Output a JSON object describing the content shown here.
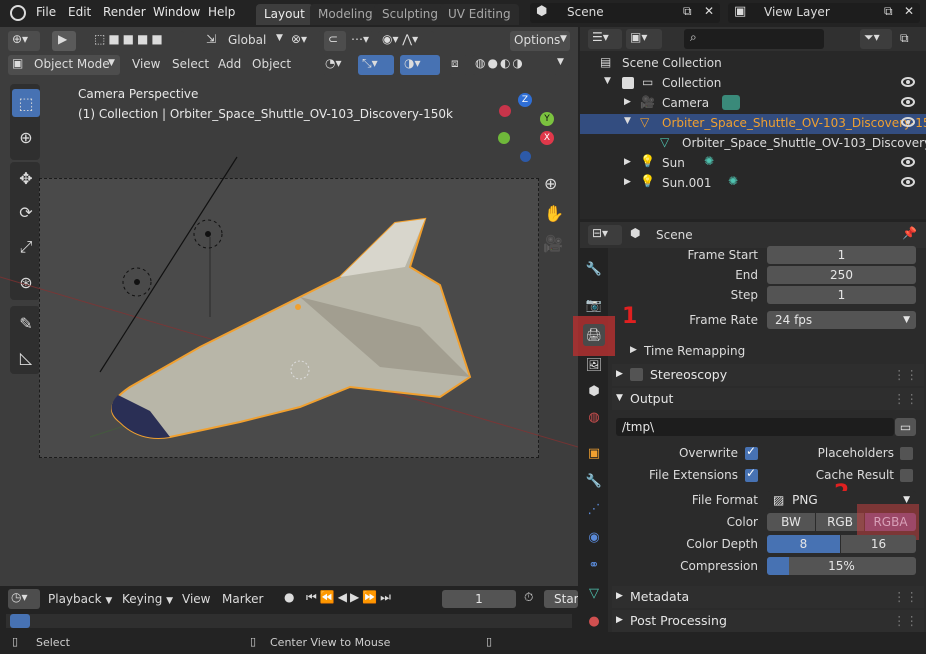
{
  "menubar": {
    "items": [
      "File",
      "Edit",
      "Render",
      "Window",
      "Help"
    ],
    "workspaces": [
      "Layout",
      "Modeling",
      "Sculpting",
      "UV Editing"
    ],
    "active_workspace": "Layout",
    "scene": "Scene",
    "view_layer": "View Layer"
  },
  "viewport": {
    "transform_orientation": "Global",
    "options_label": "Options",
    "mode": "Object Mode",
    "menu": [
      "View",
      "Select",
      "Add",
      "Object"
    ],
    "overlay_title": "Camera Perspective",
    "overlay_subtitle": "(1) Collection | Orbiter_Space_Shuttle_OV-103_Discovery-150k",
    "gizmo_axes": [
      "Z",
      "Y",
      "X"
    ]
  },
  "outliner": {
    "root": "Scene Collection",
    "rows": [
      {
        "label": "Collection",
        "indent": 1
      },
      {
        "label": "Camera",
        "indent": 2
      },
      {
        "label": "Orbiter_Space_Shuttle_OV-103_Discovery-150",
        "indent": 2
      },
      {
        "label": "Orbiter_Space_Shuttle_OV-103_Discovery-",
        "indent": 3
      },
      {
        "label": "Sun",
        "indent": 2
      },
      {
        "label": "Sun.001",
        "indent": 2
      }
    ]
  },
  "properties": {
    "context": "Scene",
    "frame_start_label": "Frame Start",
    "frame_start": "1",
    "end_label": "End",
    "end": "250",
    "step_label": "Step",
    "step": "1",
    "frame_rate_label": "Frame Rate",
    "frame_rate": "24 fps",
    "time_remapping": "Time Remapping",
    "stereoscopy": "Stereoscopy",
    "output": "Output",
    "output_path": "/tmp\\",
    "overwrite": "Overwrite",
    "placeholders": "Placeholders",
    "file_extensions": "File Extensions",
    "cache_result": "Cache Result",
    "file_format_label": "File Format",
    "file_format": "PNG",
    "color_label": "Color",
    "color_options": [
      "BW",
      "RGB",
      "RGBA"
    ],
    "color_selected": "RGBA",
    "color_depth_label": "Color Depth",
    "color_depth_options": [
      "8",
      "16"
    ],
    "color_depth_selected": "8",
    "compression_label": "Compression",
    "compression": "15%",
    "compression_fraction": 0.15,
    "metadata": "Metadata",
    "post_processing": "Post Processing"
  },
  "annotations": {
    "marker_1": "1",
    "marker_2": "2"
  },
  "timeline": {
    "menu": [
      "Playback",
      "Keying",
      "View",
      "Marker"
    ],
    "current_frame": "1",
    "start_label": "Star"
  },
  "statusbar": {
    "left": "Select",
    "middle": "Center View to Mouse"
  },
  "colors": {
    "accent_blue": "#4772b3",
    "selection_orange": "#f0a030",
    "annotation_red": "#e02020"
  }
}
